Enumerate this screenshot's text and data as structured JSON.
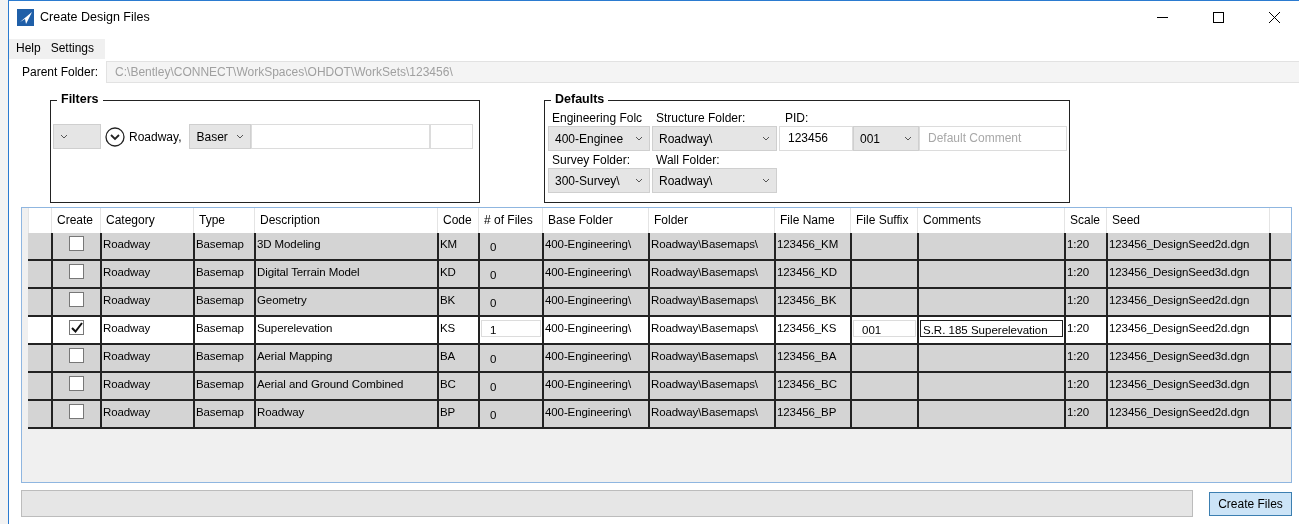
{
  "window": {
    "title": "Create Design Files"
  },
  "menu": [
    "Help",
    "Settings"
  ],
  "parent_folder": {
    "label": "Parent Folder:",
    "value": "C:\\Bentley\\CONNECT\\WorkSpaces\\OHDOT\\WorkSets\\123456\\",
    "disabled": true
  },
  "filters": {
    "title": "Filters",
    "text": "Roadway,",
    "combo_2": "Baser"
  },
  "defaults": {
    "title": "Defaults",
    "engineering_folder": {
      "label": "Engineering Folc",
      "value": "400-Enginee"
    },
    "structure_folder": {
      "label": "Structure Folder:",
      "value": "Roadway\\"
    },
    "pid": {
      "label": "PID:",
      "value": "123456"
    },
    "suffix": {
      "value": "001"
    },
    "comment": {
      "placeholder": "Default Comment"
    },
    "survey_folder": {
      "label": "Survey Folder:",
      "value": "300-Survey\\"
    },
    "wall_folder": {
      "label": "Wall Folder:",
      "value": "Roadway\\"
    }
  },
  "table": {
    "columns": [
      "Create",
      "Category",
      "Type",
      "Description",
      "Code",
      "# of Files",
      "Base Folder",
      "Folder",
      "File Name",
      "File Suffix",
      "Comments",
      "Scale",
      "Seed"
    ],
    "rows": [
      {
        "selected": false,
        "checked": false,
        "category": "Roadway",
        "type": "Basemap",
        "description": "3D Modeling",
        "code": "KM",
        "files": "0",
        "base_folder": "400-Engineering\\",
        "folder": "Roadway\\Basemaps\\",
        "file_name": "123456_KM",
        "scale": "1:20",
        "seed": "123456_DesignSeed2d.dgn"
      },
      {
        "selected": false,
        "checked": false,
        "category": "Roadway",
        "type": "Basemap",
        "description": "Digital Terrain Model",
        "code": "KD",
        "files": "0",
        "base_folder": "400-Engineering\\",
        "folder": "Roadway\\Basemaps\\",
        "file_name": "123456_KD",
        "scale": "1:20",
        "seed": "123456_DesignSeed3d.dgn"
      },
      {
        "selected": false,
        "checked": false,
        "category": "Roadway",
        "type": "Basemap",
        "description": "Geometry",
        "code": "BK",
        "files": "0",
        "base_folder": "400-Engineering\\",
        "folder": "Roadway\\Basemaps\\",
        "file_name": "123456_BK",
        "scale": "1:20",
        "seed": "123456_DesignSeed2d.dgn"
      },
      {
        "selected": true,
        "checked": true,
        "category": "Roadway",
        "type": "Basemap",
        "description": "Superelevation",
        "code": "KS",
        "files": "1",
        "base_folder": "400-Engineering\\",
        "folder": "Roadway\\Basemaps\\",
        "file_name": "123456_KS",
        "file_suffix": "001",
        "comments": "S.R. 185 Superelevation",
        "scale": "1:20",
        "seed": "123456_DesignSeed2d.dgn"
      },
      {
        "selected": false,
        "checked": false,
        "category": "Roadway",
        "type": "Basemap",
        "description": "Aerial Mapping",
        "code": "BA",
        "files": "0",
        "base_folder": "400-Engineering\\",
        "folder": "Roadway\\Basemaps\\",
        "file_name": "123456_BA",
        "scale": "1:20",
        "seed": "123456_DesignSeed3d.dgn"
      },
      {
        "selected": false,
        "checked": false,
        "category": "Roadway",
        "type": "Basemap",
        "description": "Aerial and Ground Combined",
        "code": "BC",
        "files": "0",
        "base_folder": "400-Engineering\\",
        "folder": "Roadway\\Basemaps\\",
        "file_name": "123456_BC",
        "scale": "1:20",
        "seed": "123456_DesignSeed3d.dgn"
      },
      {
        "selected": false,
        "checked": false,
        "category": "Roadway",
        "type": "Basemap",
        "description": "Roadway",
        "code": "BP",
        "files": "0",
        "base_folder": "400-Engineering\\",
        "folder": "Roadway\\Basemaps\\",
        "file_name": "123456_BP",
        "scale": "1:20",
        "seed": "123456_DesignSeed2d.dgn"
      }
    ]
  },
  "create_button": "Create Files"
}
